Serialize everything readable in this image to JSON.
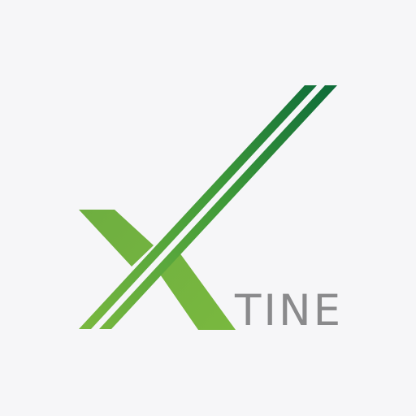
{
  "logo": {
    "wordmark": "TINE",
    "colors": {
      "background": "#f6f6f8",
      "wordmark": "#8a8a8c",
      "green_dark": "#0d6b39",
      "green_mid": "#3f9a39",
      "green_light": "#7ab83f"
    }
  }
}
